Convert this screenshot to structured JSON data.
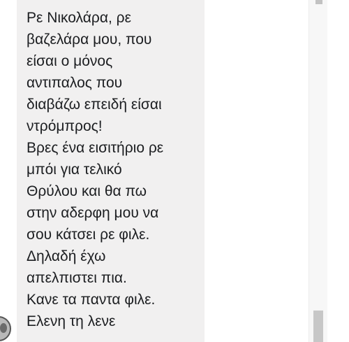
{
  "message": {
    "lines": [
      "Ρε Νικολάρα, ρε",
      "βαζελάρα μου, που",
      "είσαι ο μόνος",
      "αντιπαλος που",
      "διαβάζω επειδή είσαι",
      "ντρόμπρος!",
      "Βρες ένα εισιτήριο ρε",
      "μπόι για τελικό",
      "Θρύλου και θα πω",
      "στην αδερφη μου να",
      "σου κάτσει ρε φιλε.",
      "Δηλαδή έχω",
      "απελπιστει πια.",
      "Κανε τα παντα φιλε.",
      "Ελενη τη λενε"
    ]
  },
  "colors": {
    "bubble": "#f1f0f0",
    "text": "#1c1e21",
    "scrollbar_track": "#f7f7f7",
    "scrollbar_thumb": "#c7c7c7"
  }
}
